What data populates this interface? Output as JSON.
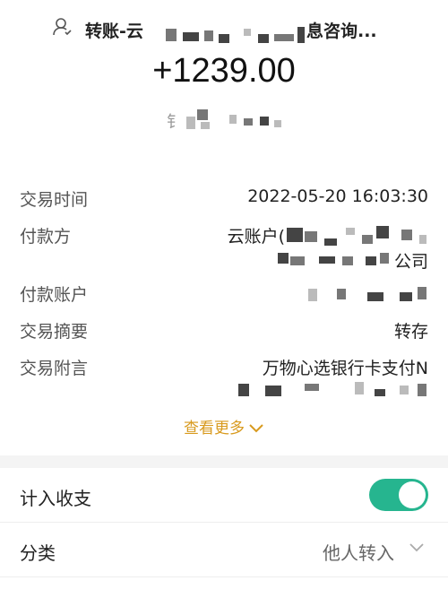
{
  "header": {
    "title": "转账-云",
    "suffix": "息咨询..."
  },
  "amount": "+1239.00",
  "payee": {
    "initial": "钅"
  },
  "details": [
    {
      "label": "交易时间",
      "value": "2022-05-20 16:03:30"
    },
    {
      "label": "付款方",
      "value": "云账户(",
      "value2": "公司"
    },
    {
      "label": "付款账户",
      "value": ""
    },
    {
      "label": "交易摘要",
      "value": "转存"
    },
    {
      "label": "交易附言",
      "value": "万物心选银行卡支付N"
    }
  ],
  "view_more": "查看更多",
  "settings": {
    "count_in": {
      "label": "计入收支",
      "on": true,
      "color": "#26b58f"
    },
    "category": {
      "label": "分类",
      "value": "他人转入"
    }
  },
  "colors": {
    "accent": "#d89a1e",
    "toggle": "#26b58f"
  }
}
